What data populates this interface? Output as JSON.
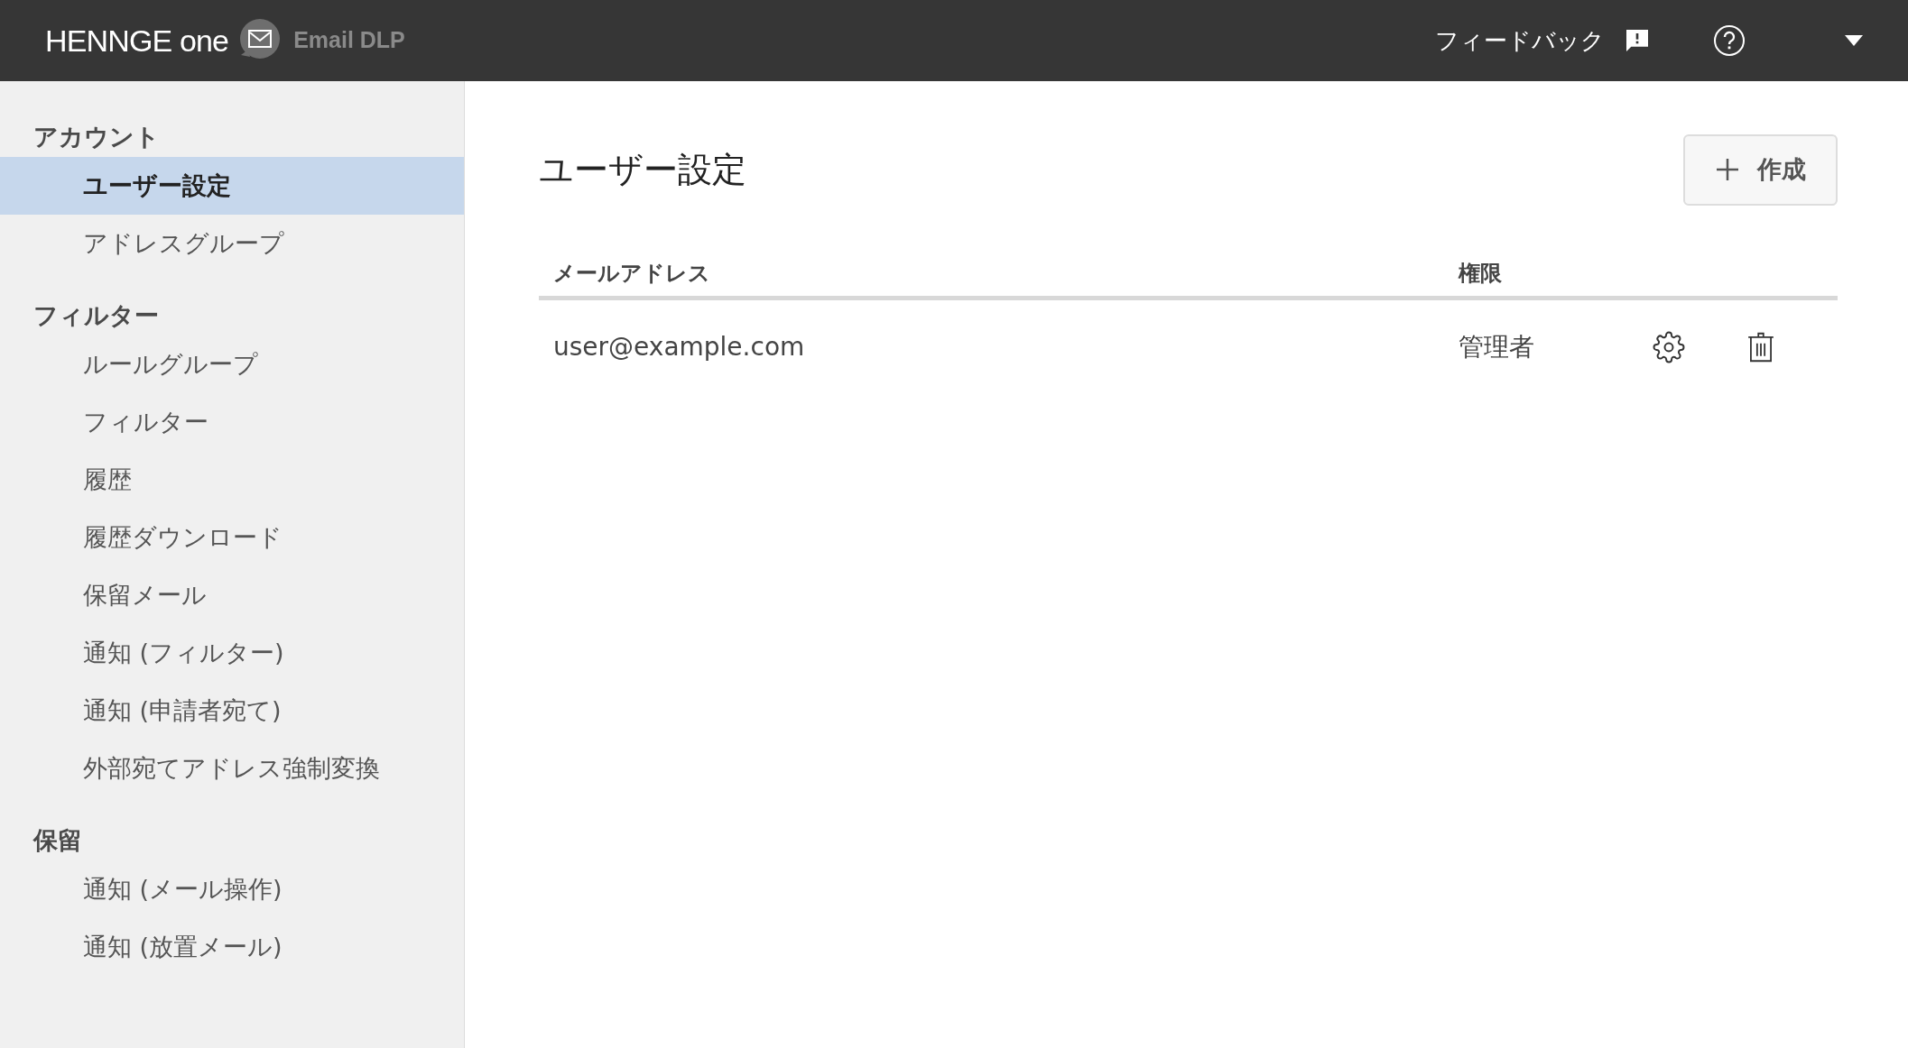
{
  "header": {
    "logo": "HENNGE one",
    "product": "Email DLP",
    "feedback": "フィードバック"
  },
  "sidebar": {
    "sections": [
      {
        "heading": "アカウント",
        "items": [
          {
            "label": "ユーザー設定",
            "selected": true
          },
          {
            "label": "アドレスグループ",
            "selected": false
          }
        ]
      },
      {
        "heading": "フィルター",
        "items": [
          {
            "label": "ルールグループ",
            "selected": false
          },
          {
            "label": "フィルター",
            "selected": false
          },
          {
            "label": "履歴",
            "selected": false
          },
          {
            "label": "履歴ダウンロード",
            "selected": false
          },
          {
            "label": "保留メール",
            "selected": false
          },
          {
            "label": "通知 (フィルター)",
            "selected": false
          },
          {
            "label": "通知 (申請者宛て)",
            "selected": false
          },
          {
            "label": "外部宛てアドレス強制変換",
            "selected": false
          }
        ]
      },
      {
        "heading": "保留",
        "items": [
          {
            "label": "通知 (メール操作)",
            "selected": false
          },
          {
            "label": "通知 (放置メール)",
            "selected": false
          }
        ]
      }
    ]
  },
  "main": {
    "title": "ユーザー設定",
    "create_button": "作成",
    "table": {
      "columns": [
        "メールアドレス",
        "権限"
      ],
      "rows": [
        {
          "email": "user@example.com",
          "role": "管理者"
        }
      ]
    }
  }
}
